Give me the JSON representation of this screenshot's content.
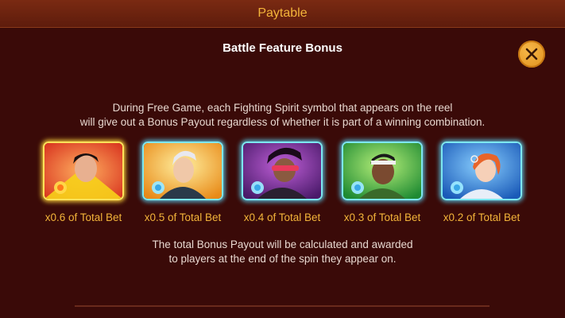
{
  "header": {
    "title": "Paytable"
  },
  "section": {
    "title": "Battle Feature Bonus"
  },
  "close": {
    "icon": "close-icon"
  },
  "description": {
    "line1": "During Free Game, each Fighting Spirit symbol that appears on the reel",
    "line2": "will give out a Bonus Payout regardless of whether it is part of a winning combination."
  },
  "symbols": [
    {
      "payout": "x0.6 of Total Bet",
      "frame": "gold",
      "bg": "#e8472a"
    },
    {
      "payout": "x0.5 of Total Bet",
      "frame": "cyan",
      "bg": "#f0a020"
    },
    {
      "payout": "x0.4 of Total Bet",
      "frame": "cyan",
      "bg": "#8a2a9a"
    },
    {
      "payout": "x0.3 of Total Bet",
      "frame": "cyan",
      "bg": "#2faa3a"
    },
    {
      "payout": "x0.2 of Total Bet",
      "frame": "cyan",
      "bg": "#2a7ad8"
    }
  ],
  "note": {
    "line1": "The total Bonus Payout will be calculated and awarded",
    "line2": "to players at the end of the spin they appear on."
  },
  "colors": {
    "background": "#3a0a08",
    "accent": "#f3b43a",
    "header": "#6a2210"
  }
}
